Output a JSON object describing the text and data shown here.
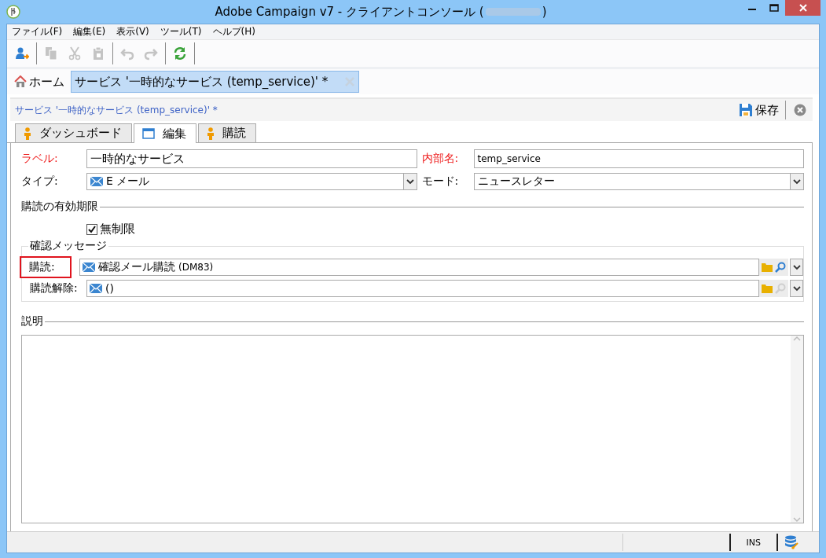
{
  "window": {
    "title": "Adobe Campaign v7 - クライアントコンソール (",
    "title_end": ")"
  },
  "menu": [
    {
      "label": "ファイル(F)"
    },
    {
      "label": "編集(E)"
    },
    {
      "label": "表示(V)"
    },
    {
      "label": "ツール(T)"
    },
    {
      "label": "ヘルプ(H)"
    }
  ],
  "toolbar": [
    {
      "kind": "user-add",
      "disabled": false
    },
    {
      "kind": "sep"
    },
    {
      "kind": "copy",
      "disabled": true
    },
    {
      "kind": "cut",
      "disabled": true
    },
    {
      "kind": "paste",
      "disabled": true
    },
    {
      "kind": "sep"
    },
    {
      "kind": "undo",
      "disabled": true
    },
    {
      "kind": "redo",
      "disabled": true
    },
    {
      "kind": "sep"
    },
    {
      "kind": "refresh",
      "disabled": false
    },
    {
      "kind": "sep"
    }
  ],
  "tabs": [
    {
      "label": "ホーム",
      "kind": "home",
      "selected": false
    },
    {
      "label": "サービス '一時的なサービス (temp_service)' *",
      "kind": "document",
      "selected": true
    }
  ],
  "header": {
    "title": "サービス '一時的なサービス (temp_service)' *",
    "save": "保存"
  },
  "subtabs": [
    {
      "label": "ダッシュボード",
      "kind": "person",
      "selected": false
    },
    {
      "label": "編集",
      "kind": "form",
      "selected": true
    },
    {
      "label": "購読",
      "kind": "person",
      "selected": false
    }
  ],
  "form": {
    "label": {
      "caption": "ラベル:",
      "required": true,
      "value": "一時的なサービス"
    },
    "internal_name": {
      "caption": "内部名:",
      "required": true,
      "value": "temp_service"
    },
    "type": {
      "caption": "タイプ:",
      "required": false,
      "value": "E メール"
    },
    "mode": {
      "caption": "モード:",
      "required": false,
      "value": "ニュースレター"
    }
  },
  "validity": {
    "heading": "購読の有効期限",
    "checkbox": {
      "label": "無制限",
      "checked": true
    }
  },
  "confirmation": {
    "heading": "確認メッセージ",
    "rows": [
      {
        "caption": "購読:",
        "highlighted": true,
        "value": "確認メール購読",
        "code": "(DM83)",
        "search_enabled": true
      },
      {
        "caption": "購読解除:",
        "highlighted": false,
        "value": "()",
        "search_enabled": false
      }
    ]
  },
  "description": {
    "heading": "説明"
  },
  "status_bar": {
    "mode": "INS"
  }
}
